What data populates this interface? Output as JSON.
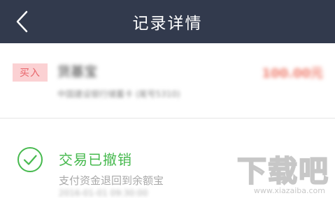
{
  "header": {
    "title": "记录详情",
    "back_icon": "chevron-left-icon"
  },
  "record": {
    "type_tag": "买入",
    "fund_name": "货基宝",
    "amount": "100.00元",
    "sub_info": "中国建设银行储蓄卡 (尾号5310)"
  },
  "status": {
    "icon": "check-circle-icon",
    "title": "交易已撤销",
    "description": "支付资金退回到余额宝",
    "sub_info": "2016-01-01 09:30:00"
  },
  "watermark": {
    "text": "下载吧",
    "url": "www.xiazaiba.com"
  },
  "colors": {
    "header_bg": "#323a4d",
    "tag_bg": "#fbd1d3",
    "tag_text": "#e8656b",
    "amount": "#ef7c6c",
    "success": "#46b94e"
  }
}
